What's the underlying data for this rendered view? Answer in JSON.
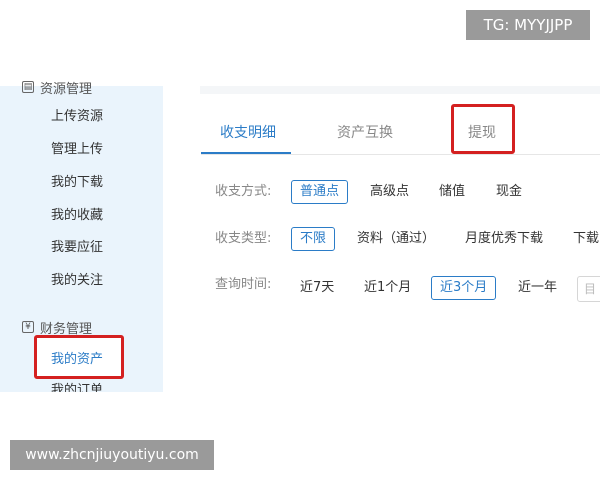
{
  "watermark_top": "TG: MYYJJPP",
  "watermark_bottom": "www.zhcnjiuyoutiyu.com",
  "sidebar": {
    "section1": {
      "icon": "folder-icon",
      "label": "资源管理"
    },
    "items": [
      "上传资源",
      "管理上传",
      "我的下载",
      "我的收藏",
      "我要应征",
      "我的关注"
    ],
    "section2": {
      "icon": "finance-icon",
      "label": "财务管理"
    },
    "active_item": "我的资产",
    "next_item": "我的订单"
  },
  "tabs": [
    {
      "label": "收支明细",
      "active": true
    },
    {
      "label": "资产互换",
      "active": false
    },
    {
      "label": "提现",
      "active": false
    }
  ],
  "filters": {
    "method": {
      "label": "收支方式:",
      "options": [
        "普通点",
        "高级点",
        "储值",
        "现金"
      ],
      "selected": "普通点"
    },
    "type": {
      "label": "收支类型:",
      "options": [
        "不限",
        "资料（通过）",
        "月度优秀下载",
        "下载"
      ],
      "selected": "不限"
    },
    "time": {
      "label": "查询时间:",
      "options": [
        "近7天",
        "近1个月",
        "近3个月",
        "近一年"
      ],
      "selected": "近3个月",
      "date_placeholder": "目"
    }
  },
  "colors": {
    "accent": "#2b7cc7",
    "highlight": "#d42020",
    "sidebar_bg": "#eaf4fc"
  }
}
